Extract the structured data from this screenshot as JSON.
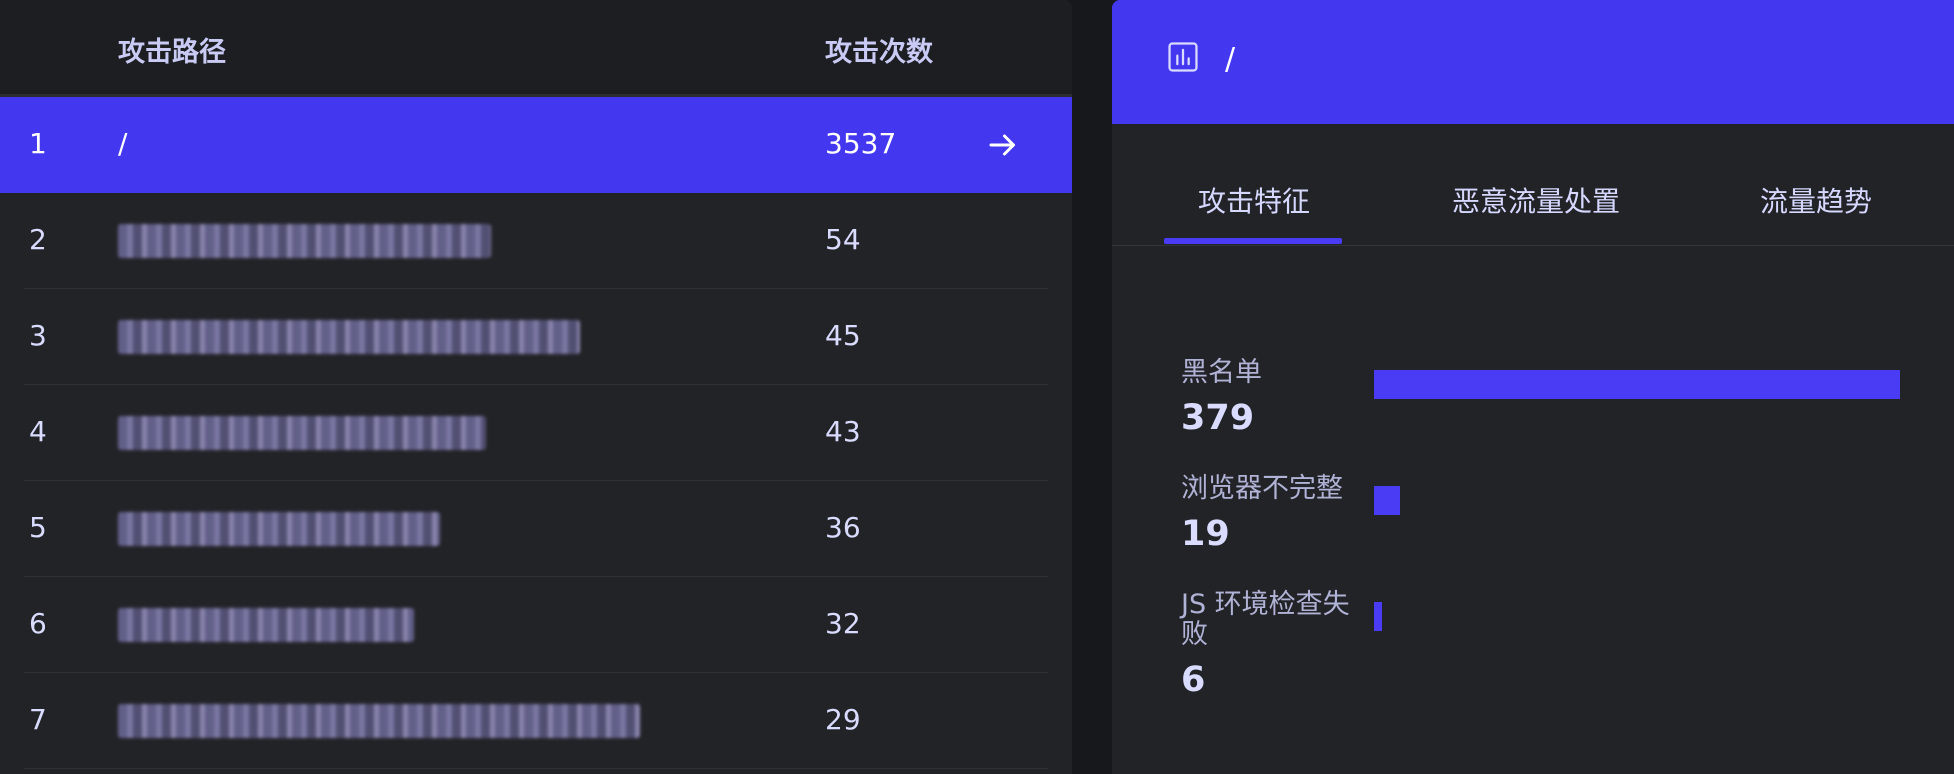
{
  "attack_table": {
    "header": {
      "path_label": "攻击路径",
      "count_label": "攻击次数"
    },
    "rows": [
      {
        "index": "1",
        "path": "/",
        "count": "3537",
        "active": true
      },
      {
        "index": "2",
        "path": "",
        "count": "54"
      },
      {
        "index": "3",
        "path": "",
        "count": "45"
      },
      {
        "index": "4",
        "path": "",
        "count": "43"
      },
      {
        "index": "5",
        "path": "",
        "count": "36"
      },
      {
        "index": "6",
        "path": "",
        "count": "32"
      },
      {
        "index": "7",
        "path": "",
        "count": "29"
      }
    ]
  },
  "detail_panel": {
    "icon": "bar-chart-icon",
    "title": "/",
    "tabs": [
      {
        "label": "攻击特征",
        "selected": true
      },
      {
        "label": "恶意流量处置",
        "selected": false
      },
      {
        "label": "流量趋势",
        "selected": false
      }
    ],
    "features": [
      {
        "label": "黑名单",
        "value": "379",
        "level": 379
      },
      {
        "label": "浏览器不完整",
        "value": "19",
        "level": 19
      },
      {
        "label": "JS 环境检查失败",
        "value": "6",
        "level": 6
      }
    ],
    "accent_color": "#4437f0"
  }
}
